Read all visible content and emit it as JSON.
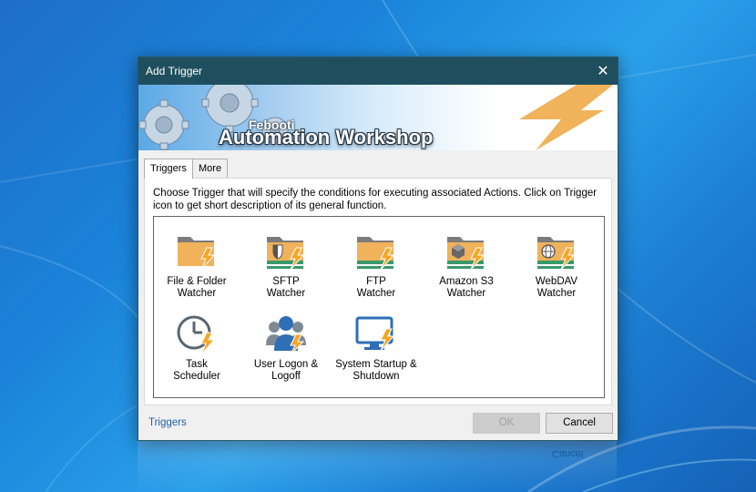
{
  "window": {
    "title": "Add Trigger",
    "close_glyph": "✕"
  },
  "banner": {
    "brand": "Febooti",
    "product": "Automation Workshop"
  },
  "tabs": [
    {
      "label": "Triggers",
      "active": true
    },
    {
      "label": "More",
      "active": false
    }
  ],
  "description": "Choose Trigger that will specify the conditions for executing associated Actions. Click on Trigger icon to get short description of its general function.",
  "triggers": [
    {
      "label_line1": "File & Folder",
      "label_line2": "Watcher",
      "icon": "folder-watcher-icon"
    },
    {
      "label_line1": "SFTP",
      "label_line2": "Watcher",
      "icon": "sftp-watcher-icon"
    },
    {
      "label_line1": "FTP",
      "label_line2": "Watcher",
      "icon": "ftp-watcher-icon"
    },
    {
      "label_line1": "Amazon S3",
      "label_line2": "Watcher",
      "icon": "amazon-s3-watcher-icon"
    },
    {
      "label_line1": "WebDAV",
      "label_line2": "Watcher",
      "icon": "webdav-watcher-icon"
    },
    {
      "label_line1": "Task",
      "label_line2": "Scheduler",
      "icon": "clock-icon"
    },
    {
      "label_line1": "User Logon &",
      "label_line2": "Logoff",
      "icon": "users-icon"
    },
    {
      "label_line1": "System Startup &",
      "label_line2": "Shutdown",
      "icon": "monitor-icon"
    }
  ],
  "footer": {
    "link": "Triggers",
    "ok_label": "OK",
    "cancel_label": "Cancel",
    "ok_enabled": false
  },
  "colors": {
    "titlebar": "#1f4f5e",
    "folder": "#f0b25a",
    "bolt": "#f5a623",
    "accent_link": "#1f5fa6"
  }
}
